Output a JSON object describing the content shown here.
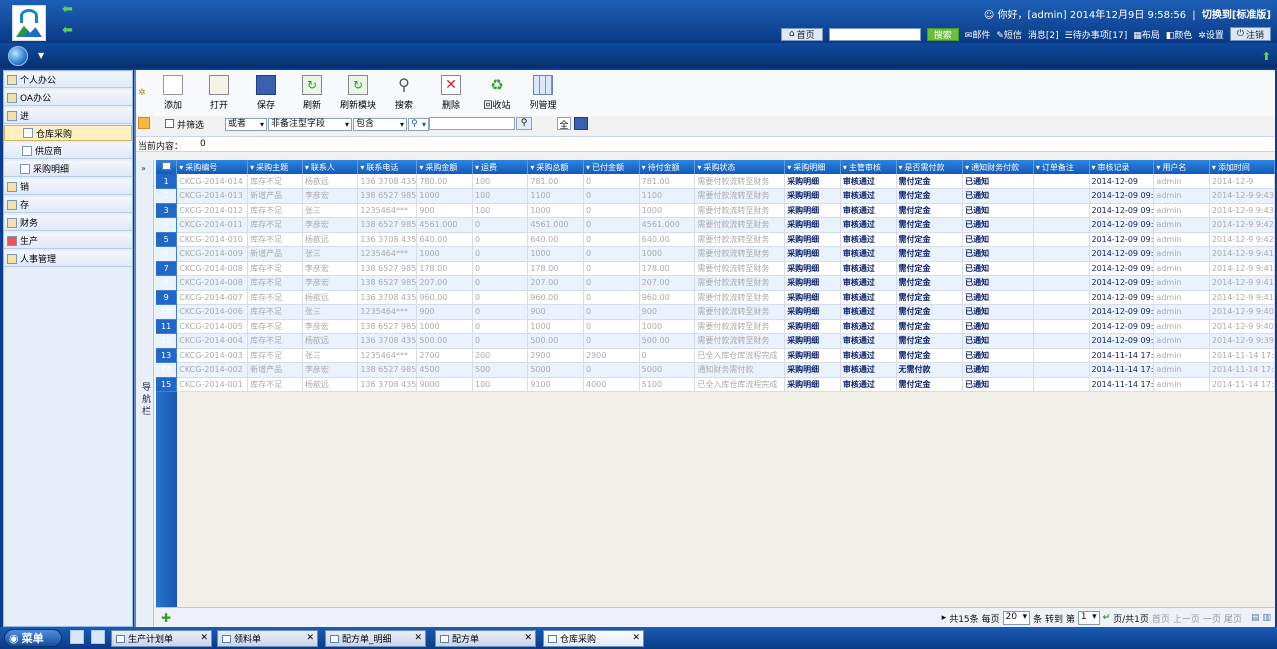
{
  "header": {
    "greeting": "你好，[admin] 2014年12月9日 9:58:56",
    "switch_label": "切换到[标准版]",
    "home_label": "首页",
    "search_button": "搜索",
    "mail_label": "邮件",
    "sms_label": "短信",
    "messages_label": "消息[2]",
    "todo_label": "待办事项[17]",
    "layout_label": "布局",
    "color_label": "颜色",
    "settings_label": "设置",
    "logout_label": "注销"
  },
  "sidebar": {
    "items": [
      {
        "label": "个人办公"
      },
      {
        "label": "OA办公"
      },
      {
        "label": "进"
      },
      {
        "label": "仓库采购"
      },
      {
        "label": "供应商"
      },
      {
        "label": "采购明细"
      },
      {
        "label": "销"
      },
      {
        "label": "存"
      },
      {
        "label": "财务"
      },
      {
        "label": "生产"
      },
      {
        "label": "人事管理"
      }
    ]
  },
  "toolbar": {
    "add": "添加",
    "open": "打开",
    "save": "保存",
    "refresh": "刷新",
    "refresh_module": "刷新模块",
    "search": "搜索",
    "delete": "删除",
    "recycle": "回收站",
    "columns": "列管理"
  },
  "filter": {
    "checkbox_label": "并筛选",
    "logic": "或者",
    "field": "非备注型字段",
    "op": "包含",
    "all_label": "全"
  },
  "current": {
    "label": "当前内容：",
    "value": "0"
  },
  "nav_label": "导航栏",
  "grid": {
    "headers": [
      "采购编号",
      "采购主题",
      "联系人",
      "联系电话",
      "采购金额",
      "运费",
      "采购总额",
      "已付金额",
      "待付金额",
      "采购状态",
      "采购明细",
      "主管审核",
      "是否需付款",
      "通知财务付款",
      "订单备注",
      "审核记录",
      "用户名",
      "添加时间"
    ],
    "rows": [
      [
        "CKCG-2014-014",
        "库存不足",
        "杨歆远",
        "136 3708 435",
        "780.00",
        "100",
        "781.00",
        "0",
        "781.00",
        "需要付款流转至财务",
        "采购明细",
        "审核通过",
        "需付定金",
        "已通知",
        "",
        "2014-12-09",
        "admin",
        "2014-12-9"
      ],
      [
        "CKCG-2014-013",
        "新增产品",
        "李彦宏",
        "138 6527 985",
        "1000",
        "100",
        "1100",
        "0",
        "1100",
        "需要付款流转至财务",
        "采购明细",
        "审核通过",
        "需付定金",
        "已通知",
        "",
        "2014-12-09 09:",
        "admin",
        "2014-12-9 9:43"
      ],
      [
        "CKCG-2014-012",
        "库存不足",
        "张三",
        "1235464***",
        "900",
        "100",
        "1000",
        "0",
        "1000",
        "需要付款流转至财务",
        "采购明细",
        "审核通过",
        "需付定金",
        "已通知",
        "",
        "2014-12-09 09:",
        "admin",
        "2014-12-9 9:43"
      ],
      [
        "CKCG-2014-011",
        "库存不足",
        "李彦宏",
        "138 6527 985",
        "4561.000",
        "0",
        "4561.000",
        "0",
        "4561.000",
        "需要付款流转至财务",
        "采购明细",
        "审核通过",
        "需付定金",
        "已通知",
        "",
        "2014-12-09 09:",
        "admin",
        "2014-12-9 9:42"
      ],
      [
        "CKCG-2014-010",
        "库存不足",
        "杨歆远",
        "136 3708 435",
        "640.00",
        "0",
        "640.00",
        "0",
        "640.00",
        "需要付款流转至财务",
        "采购明细",
        "审核通过",
        "需付定金",
        "已通知",
        "",
        "2014-12-09 09:",
        "admin",
        "2014-12-9 9:42"
      ],
      [
        "CKCG-2014-009",
        "新增产品",
        "张三",
        "1235464***",
        "1000",
        "0",
        "1000",
        "0",
        "1000",
        "需要付款流转至财务",
        "采购明细",
        "审核通过",
        "需付定金",
        "已通知",
        "",
        "2014-12-09 09:",
        "admin",
        "2014-12-9 9:41"
      ],
      [
        "CKCG-2014-008",
        "库存不足",
        "李彦宏",
        "138 6527 985",
        "178.00",
        "0",
        "178.00",
        "0",
        "178.00",
        "需要付款流转至财务",
        "采购明细",
        "审核通过",
        "需付定金",
        "已通知",
        "",
        "2014-12-09 09:",
        "admin",
        "2014-12-9 9:41"
      ],
      [
        "CKCG-2014-008",
        "库存不足",
        "李彦宏",
        "138 6527 985",
        "207.00",
        "0",
        "207.00",
        "0",
        "207.00",
        "需要付款流转至财务",
        "采购明细",
        "审核通过",
        "需付定金",
        "已通知",
        "",
        "2014-12-09 09:",
        "admin",
        "2014-12-9 9:41"
      ],
      [
        "CKCG-2014-007",
        "库存不足",
        "杨歆远",
        "136 3708 435",
        "960.00",
        "0",
        "960.00",
        "0",
        "960.00",
        "需要付款流转至财务",
        "采购明细",
        "审核通过",
        "需付定金",
        "已通知",
        "",
        "2014-12-09 09:",
        "admin",
        "2014-12-9 9:41"
      ],
      [
        "CKCG-2014-006",
        "库存不足",
        "张三",
        "1235464***",
        "900",
        "0",
        "900",
        "0",
        "900",
        "需要付款流转至财务",
        "采购明细",
        "审核通过",
        "需付定金",
        "已通知",
        "",
        "2014-12-09 09:",
        "admin",
        "2014-12-9 9:40"
      ],
      [
        "CKCG-2014-005",
        "库存不足",
        "李彦宏",
        "138 6527 985",
        "1000",
        "0",
        "1000",
        "0",
        "1000",
        "需要付款流转至财务",
        "采购明细",
        "审核通过",
        "需付定金",
        "已通知",
        "",
        "2014-12-09 09:",
        "admin",
        "2014-12-9 9:40"
      ],
      [
        "CKCG-2014-004",
        "库存不足",
        "杨歆远",
        "136 3708 435",
        "500.00",
        "0",
        "500.00",
        "0",
        "500.00",
        "需要付款流转至财务",
        "采购明细",
        "审核通过",
        "需付定金",
        "已通知",
        "",
        "2014-12-09 09:",
        "admin",
        "2014-12-9 9:39"
      ],
      [
        "CKCG-2014-003",
        "库存不足",
        "张三",
        "1235464***",
        "2700",
        "200",
        "2900",
        "2900",
        "0",
        "已全入库仓库流程完成",
        "采购明细",
        "审核通过",
        "需付定金",
        "已通知",
        "",
        "2014-11-14 17:",
        "admin",
        "2014-11-14 17:"
      ],
      [
        "CKCG-2014-002",
        "新增产品",
        "李彦宏",
        "138 6527 985",
        "4500",
        "500",
        "5000",
        "0",
        "5000",
        "通知财务需付款",
        "采购明细",
        "审核通过",
        "无需付款",
        "已通知",
        "",
        "2014-11-14 17:",
        "admin",
        "2014-11-14 17:"
      ],
      [
        "CKCG-2014-001",
        "库存不足",
        "杨歆远",
        "136 3708 435",
        "9000",
        "100",
        "9100",
        "4000",
        "5100",
        "已全入库仓库流程完成",
        "采购明细",
        "审核通过",
        "需付定金",
        "已通知",
        "",
        "2014-11-14 17:",
        "admin",
        "2014-11-14 17:"
      ]
    ]
  },
  "pager": {
    "total": "共15条",
    "per_page_label": "每页",
    "per_page": "20",
    "goto_label": "条 转到 第",
    "page": "1",
    "page_info": "页/共1页",
    "first": "首页",
    "prev": "上一页",
    "next": "一页",
    "last": "尾页"
  },
  "taskbar": {
    "start": "菜单",
    "tabs": [
      "生产计划单",
      "领料单",
      "配方单_明细",
      "配方单",
      "仓库采购"
    ]
  }
}
